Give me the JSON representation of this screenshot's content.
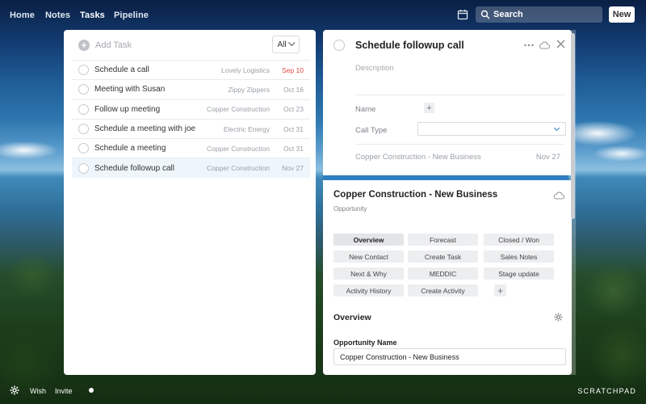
{
  "nav": {
    "links": [
      "Home",
      "Notes",
      "Tasks",
      "Pipeline"
    ],
    "active": "Tasks",
    "search_label": "Search",
    "new_label": "New"
  },
  "tasks": {
    "add_label": "Add Task",
    "filter_label": "All",
    "rows": [
      {
        "title": "Schedule a call",
        "company": "Lovely Logistics",
        "date": "Sep 10",
        "overdue": true
      },
      {
        "title": "Meeting with Susan",
        "company": "Zippy Zippers",
        "date": "Oct 16"
      },
      {
        "title": "Follow up meeting",
        "company": "Copper Construction",
        "date": "Oct 23"
      },
      {
        "title": "Schedule a meeting with joe",
        "company": "Electric Energy",
        "date": "Oct 31"
      },
      {
        "title": "Schedule a meeting",
        "company": "Copper Construction",
        "date": "Oct 31"
      },
      {
        "title": "Schedule followup call",
        "company": "Copper Construction",
        "date": "Nov 27",
        "selected": true
      }
    ]
  },
  "detail": {
    "title": "Schedule followup call",
    "description_placeholder": "Description",
    "name_label": "Name",
    "call_type_label": "Call Type",
    "related": "Copper Construction - New Business",
    "related_date": "Nov 27"
  },
  "opportunity": {
    "title": "Copper Construction - New Business",
    "subtitle": "Opportunity",
    "buttons": [
      "Overview",
      "Forecast",
      "Closed / Won",
      "New Contact",
      "Create Task",
      "Sales Notes",
      "Next & Why",
      "MEDDIC",
      "Stage update",
      "Activity History",
      "Create Activity"
    ],
    "section_title": "Overview",
    "name_label": "Opportunity Name",
    "name_value": "Copper Construction - New Business"
  },
  "bottom": {
    "wish": "Wish",
    "invite": "Invite",
    "brand": "SCRATCHPAD"
  },
  "colors": {
    "accent": "#2f7dc1",
    "overdue": "#e0483f"
  }
}
